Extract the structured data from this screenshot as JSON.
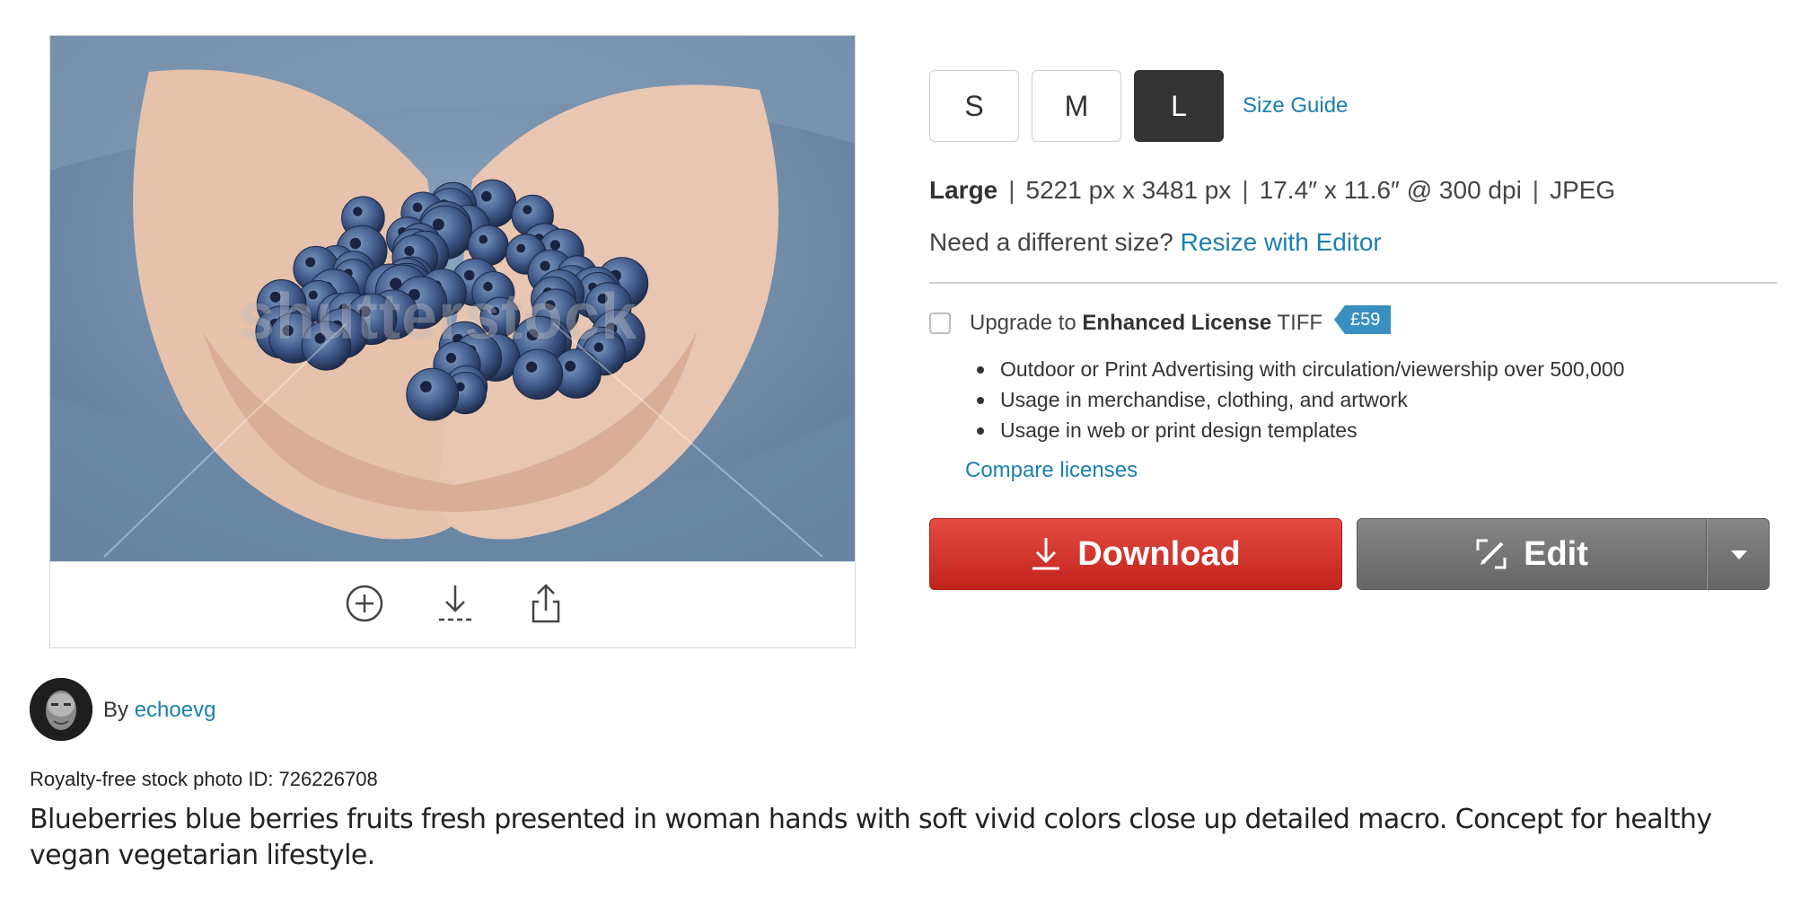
{
  "image": {
    "alt": "Blueberries in woman hands",
    "watermark": "shutterstock"
  },
  "actions": {
    "add_icon": "plus-circle-icon",
    "download_icon": "download-icon",
    "share_icon": "share-icon"
  },
  "sizes": {
    "options": [
      "S",
      "M",
      "L"
    ],
    "selected": "L",
    "guide_label": "Size Guide"
  },
  "spec": {
    "size_name": "Large",
    "separator": "|",
    "pixels": "5221 px x 3481 px",
    "print_size": "17.4″ x 11.6″ @ 300 dpi",
    "format": "JPEG"
  },
  "resize": {
    "prompt": "Need a different size?",
    "link": "Resize with Editor"
  },
  "license": {
    "prefix": "Upgrade to",
    "name": "Enhanced License",
    "suffix": "TIFF",
    "price": "£59",
    "checked": false,
    "benefits": [
      "Outdoor or Print Advertising with circulation/viewership over 500,000",
      "Usage in merchandise, clothing, and artwork",
      "Usage in web or print design templates"
    ],
    "compare_link": "Compare licenses"
  },
  "buttons": {
    "download_label": "Download",
    "edit_label": "Edit"
  },
  "author": {
    "by_label": "By",
    "name": "echoevg"
  },
  "photo_info": {
    "id_text": "Royalty-free stock photo ID: 726226708",
    "description": "Blueberries blue berries fruits fresh presented in woman hands with soft vivid colors close up detailed macro. Concept for healthy vegan vegetarian lifestyle."
  },
  "colors": {
    "link": "#1b7fb0",
    "download": "#d33029",
    "edit": "#777777",
    "price_tag": "#3a8fc1",
    "selected_size": "#333333"
  }
}
